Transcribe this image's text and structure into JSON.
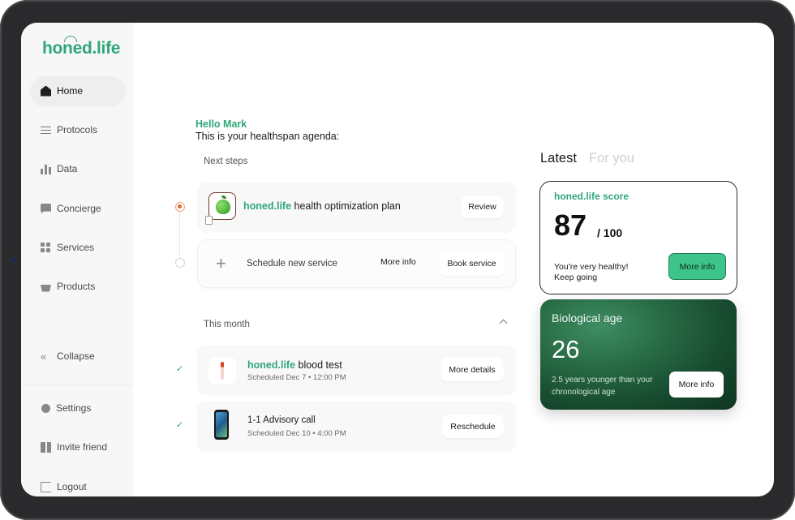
{
  "app": {
    "logo": "honed.life"
  },
  "sidebar": {
    "items": [
      {
        "label": "Home"
      },
      {
        "label": "Protocols"
      },
      {
        "label": "Data"
      },
      {
        "label": "Concierge"
      },
      {
        "label": "Services"
      },
      {
        "label": "Products"
      }
    ],
    "collapse": "Collapse",
    "footer": [
      {
        "label": "Settings"
      },
      {
        "label": "Invite friend"
      },
      {
        "label": "Logout"
      }
    ]
  },
  "greeting": {
    "name": "Hello Mark",
    "subtitle": "This is your healthspan agenda:"
  },
  "next_steps": {
    "label": "Next steps",
    "plan": {
      "brand": "honed.life",
      "title": " health optimization plan",
      "action": "Review"
    },
    "schedule": {
      "title": "Schedule new service",
      "info": "More info",
      "action": "Book service"
    }
  },
  "this_month": {
    "label": "This month",
    "items": [
      {
        "brand": "honed.life",
        "title": " blood test",
        "meta": "Scheduled Dec 7  •  12:00 PM",
        "action": "More details"
      },
      {
        "brand": "",
        "title": "1-1 Advisory call",
        "meta": "Scheduled Dec 10  •  4:00 PM",
        "action": "Reschedule"
      }
    ]
  },
  "tabs": {
    "latest": "Latest",
    "for_you": "For you"
  },
  "score_card": {
    "title": "honed.life score",
    "value": "87",
    "max": "/ 100",
    "message": "You're very healthy! Keep going",
    "action": "More info",
    "accent": "#3cc48b"
  },
  "bio_card": {
    "title": "Biological age",
    "value": "26",
    "message": "2.5 years younger than your chronological age",
    "action": "More info"
  },
  "colors": {
    "brand": "#2fa679",
    "active_dot": "#e8652f"
  }
}
